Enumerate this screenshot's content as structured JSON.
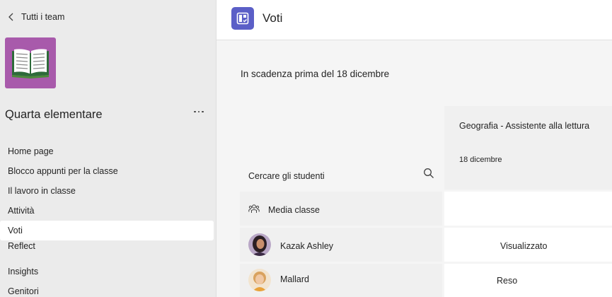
{
  "sidebar": {
    "back_label": "Tutti i team",
    "team_name": "Quarta elementare",
    "team_tile_color": "#a85aab",
    "team_icon": "book-icon",
    "nav": [
      {
        "label": "Home page"
      },
      {
        "label": "Blocco appunti per la classe"
      },
      {
        "label": "Il lavoro in classe"
      },
      {
        "label": "Attività"
      },
      {
        "label": "Voti",
        "active": true
      },
      {
        "label": "Reflect"
      },
      {
        "label": "Insights"
      },
      {
        "label": "Genitori"
      }
    ]
  },
  "header": {
    "title": "Voti",
    "app_icon": "grades-icon",
    "accent": "#5b5fc7"
  },
  "grades": {
    "due_heading": "In scadenza prima del 18 dicembre",
    "search_label": "Cercare gli studenti",
    "assignment": {
      "title": "Geografia - Assistente alla lettura",
      "date": "18 dicembre"
    },
    "class_average_label": "Media classe",
    "students": [
      {
        "name": "Kazak Ashley",
        "status": "Visualizzato"
      },
      {
        "name": "Mallard",
        "status": "Reso"
      }
    ]
  }
}
